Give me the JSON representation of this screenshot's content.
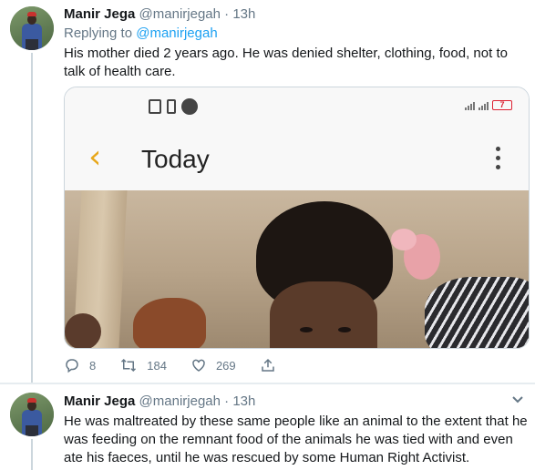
{
  "tweets": [
    {
      "author_name": "Manir Jega",
      "handle": "@manirjegah",
      "separator": "·",
      "time": "13h",
      "reply_prefix": "Replying to",
      "reply_handle": "@manirjegah",
      "text_line1": "His mother died 2 years ago. He was denied shelter, clothing, food, not to",
      "text_line2": "talk of health care.",
      "media": {
        "status_battery": "7",
        "app_title": "Today",
        "icons": [
          "gallery-icon",
          "battery-small-icon",
          "record-icon",
          "signal-icon",
          "back-chevron-icon",
          "more-vertical-icon"
        ]
      },
      "actions": {
        "replies": "8",
        "retweets": "184",
        "likes": "269"
      }
    },
    {
      "author_name": "Manir Jega",
      "handle": "@manirjegah",
      "separator": "·",
      "time": "13h",
      "text_line1": "He was maltreated by these same people like an animal to the extent that he",
      "text_line2": "was feeding on the remnant food of the animals he was tied with and even",
      "text_line3": "ate his faeces, until he was rescued by some Human Right Activist."
    }
  ],
  "colors": {
    "link": "#1da1f2",
    "muted": "#657786",
    "accent_back": "#e8a81c"
  }
}
